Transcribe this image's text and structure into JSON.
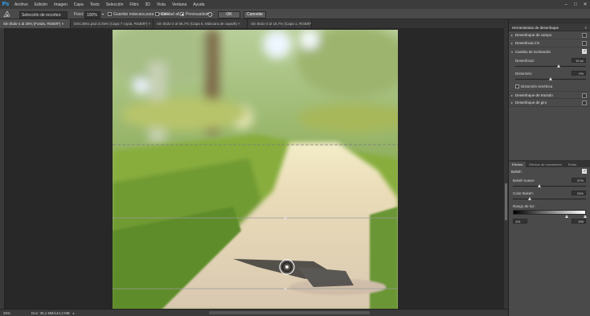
{
  "app": {
    "logo": "Ps"
  },
  "menu": [
    "Archivo",
    "Edición",
    "Imagen",
    "Capa",
    "Texto",
    "Selección",
    "Filtro",
    "3D",
    "Vista",
    "Ventana",
    "Ayuda"
  ],
  "window_controls": {
    "minimize": "–",
    "maximize": "□",
    "close": "✕"
  },
  "options_bar": {
    "selection_label": "Selección de recortes:",
    "focus_label": "Foco:",
    "focus_value": "100%",
    "save_mask_label": "Guardar máscara para canales",
    "high_quality_label": "Calidad alta",
    "preview_label": "Previsualizar",
    "ok_label": "OK",
    "cancel_label": "Cancelar"
  },
  "tabs": [
    {
      "label": "Sin título-1 al 25% (Fondo, RGB/8*) ×",
      "active": true
    },
    {
      "label": "DSC4861.psd al 25% (Capa 7 copia, RGB/8*) ×",
      "active": false
    },
    {
      "label": "Sin título-2 al 66,7% (Capa 6, Máscara de capa/8) ×",
      "active": false
    },
    {
      "label": "Sin título-3 al 16,7% (Capa 1, RGB/8*) ×",
      "active": false
    }
  ],
  "status": {
    "zoom": "25%",
    "doc": "Doc: 35,1 MB/144,3 MB"
  },
  "panel": {
    "title": "Herramientas de desenfoque",
    "tools": [
      {
        "label": "Desenfoque de campo",
        "enabled": false,
        "expanded": false
      },
      {
        "label": "Desenfocar iris",
        "enabled": false,
        "expanded": false
      },
      {
        "label": "Cambio de inclinación",
        "enabled": true,
        "expanded": true
      },
      {
        "label": "Desenfoque de trazado",
        "enabled": false,
        "expanded": false
      },
      {
        "label": "Desenfoque de giro",
        "enabled": false,
        "expanded": false
      }
    ],
    "tilt": {
      "blur_label": "Desenfocar:",
      "blur_value": "15 px",
      "blur_pos": 0.62,
      "distortion_label": "Distorsión:",
      "distortion_value": "0%",
      "distortion_pos": 0.5,
      "symmetric_label": "Distorsión simétrica"
    },
    "effects_tabs": [
      "Efectos",
      "Efectos de movimiento",
      "Ruido"
    ],
    "bokeh": {
      "title": "Bokeh",
      "enabled": true,
      "light_label": "Bokeh suave:",
      "light_value": "37%",
      "light_pos": 0.37,
      "color_label": "Color Bokeh:",
      "color_value": "24%",
      "color_pos": 0.24,
      "range_label": "Rango de luz:",
      "range_low": "191",
      "range_high": "255",
      "range_low_pos": 0.75,
      "range_high_pos": 1.0
    }
  }
}
